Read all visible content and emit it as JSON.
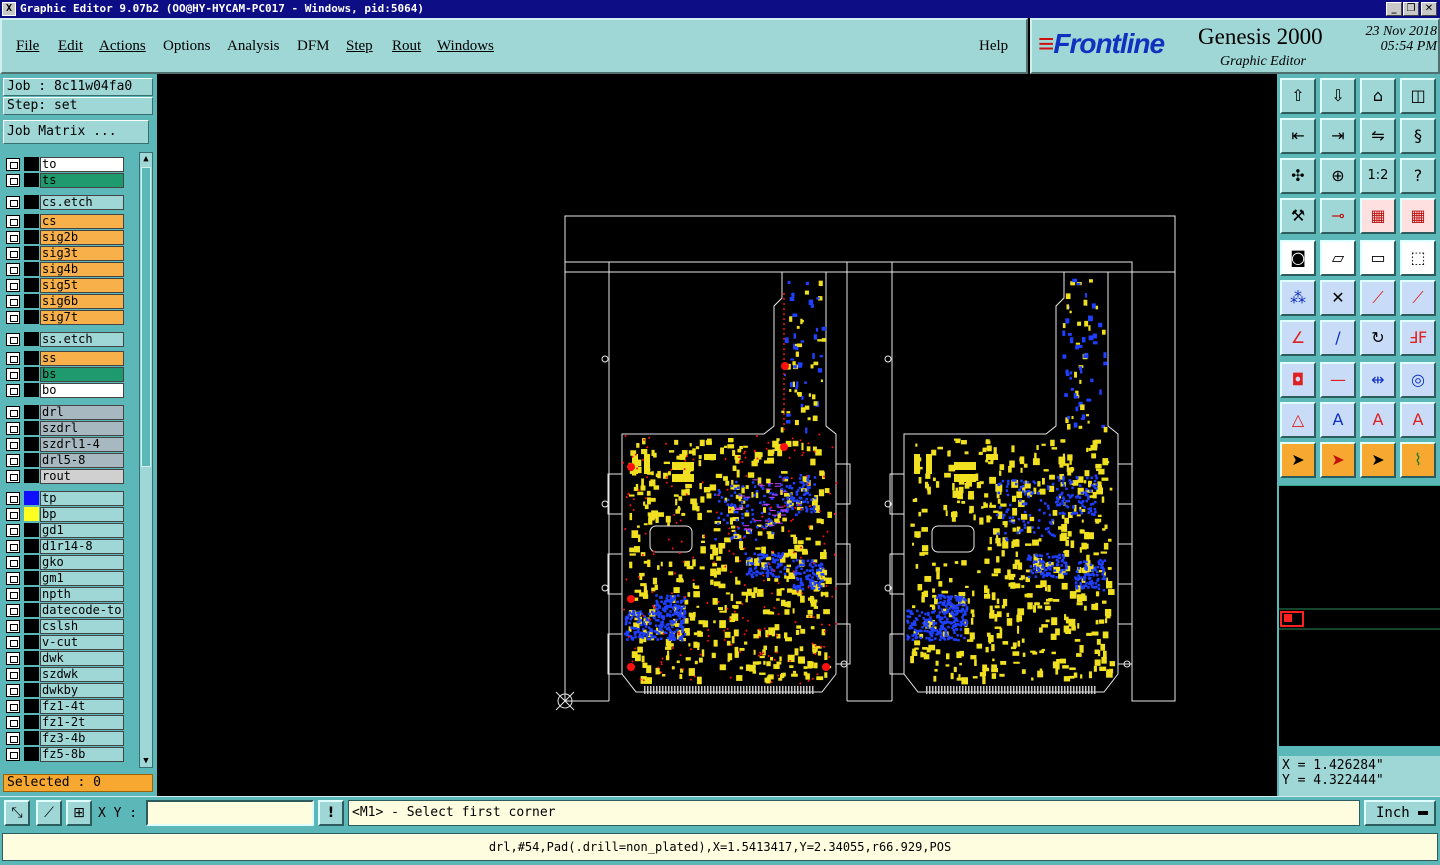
{
  "window": {
    "title": "Graphic Editor 9.07b2 (OO@HY-HYCAM-PC017 - Windows, pid:5064)",
    "minimize": "_",
    "restore": "❐",
    "close": "✕"
  },
  "menubar": {
    "items": [
      {
        "label": "File"
      },
      {
        "label": "Edit"
      },
      {
        "label": "Actions"
      },
      {
        "label": "Options"
      },
      {
        "label": "Analysis"
      },
      {
        "label": "DFM"
      },
      {
        "label": "Step"
      },
      {
        "label": "Rout"
      },
      {
        "label": "Windows"
      }
    ],
    "help": "Help"
  },
  "brand": {
    "logo": "Frontline",
    "product": "Genesis 2000",
    "subtitle": "Graphic Editor",
    "date": "23 Nov 2018",
    "time": "05:54 PM"
  },
  "job": {
    "job_label": "Job : 8c11w04fa0",
    "step_label": "Step: set",
    "matrix_button": "Job Matrix ..."
  },
  "layers": [
    {
      "name": "to",
      "color": "#ffffff",
      "swatch": "#000000"
    },
    {
      "name": "ts",
      "color": "#1e9a6e",
      "swatch": "#000000"
    },
    {
      "name": "cs.etch",
      "color": "#9fd6d6",
      "swatch": "#000000"
    },
    {
      "name": "cs",
      "color": "#f7b04a",
      "swatch": "#000000"
    },
    {
      "name": "sig2b",
      "color": "#f7b04a",
      "swatch": "#000000"
    },
    {
      "name": "sig3t",
      "color": "#f7b04a",
      "swatch": "#000000"
    },
    {
      "name": "sig4b",
      "color": "#f7b04a",
      "swatch": "#000000"
    },
    {
      "name": "sig5t",
      "color": "#f7b04a",
      "swatch": "#000000"
    },
    {
      "name": "sig6b",
      "color": "#f7b04a",
      "swatch": "#000000"
    },
    {
      "name": "sig7t",
      "color": "#f7b04a",
      "swatch": "#000000"
    },
    {
      "name": "ss.etch",
      "color": "#9fd6d6",
      "swatch": "#000000"
    },
    {
      "name": "ss",
      "color": "#f7b04a",
      "swatch": "#000000"
    },
    {
      "name": "bs",
      "color": "#1e9a6e",
      "swatch": "#000000"
    },
    {
      "name": "bo",
      "color": "#ffffff",
      "swatch": "#000000"
    },
    {
      "name": "drl",
      "color": "#a8b8c0",
      "swatch": "#000000"
    },
    {
      "name": "szdrl",
      "color": "#a8b8c0",
      "swatch": "#000000"
    },
    {
      "name": "szdrl1-4",
      "color": "#a8b8c0",
      "swatch": "#000000"
    },
    {
      "name": "drl5-8",
      "color": "#a8b8c0",
      "swatch": "#000000"
    },
    {
      "name": "rout",
      "color": "#d0d0d0",
      "swatch": "#000000"
    },
    {
      "name": "tp",
      "color": "#9fd6d6",
      "swatch": "#1010ff"
    },
    {
      "name": "bp",
      "color": "#9fd6d6",
      "swatch": "#ffff20"
    },
    {
      "name": "gd1",
      "color": "#9fd6d6",
      "swatch": "#000000"
    },
    {
      "name": "d1r14-8",
      "color": "#9fd6d6",
      "swatch": "#000000"
    },
    {
      "name": "gko",
      "color": "#9fd6d6",
      "swatch": "#000000"
    },
    {
      "name": "gm1",
      "color": "#9fd6d6",
      "swatch": "#000000"
    },
    {
      "name": "npth",
      "color": "#9fd6d6",
      "swatch": "#000000"
    },
    {
      "name": "datecode-to",
      "color": "#9fd6d6",
      "swatch": "#000000"
    },
    {
      "name": "cslsh",
      "color": "#9fd6d6",
      "swatch": "#000000"
    },
    {
      "name": "v-cut",
      "color": "#9fd6d6",
      "swatch": "#000000"
    },
    {
      "name": "dwk",
      "color": "#9fd6d6",
      "swatch": "#000000"
    },
    {
      "name": "szdwk",
      "color": "#9fd6d6",
      "swatch": "#000000"
    },
    {
      "name": "dwkby",
      "color": "#9fd6d6",
      "swatch": "#000000"
    },
    {
      "name": "fz1-4t",
      "color": "#9fd6d6",
      "swatch": "#000000"
    },
    {
      "name": "fz1-2t",
      "color": "#9fd6d6",
      "swatch": "#000000"
    },
    {
      "name": "fz3-4b",
      "color": "#9fd6d6",
      "swatch": "#000000"
    },
    {
      "name": "fz5-8b",
      "color": "#9fd6d6",
      "swatch": "#000000"
    }
  ],
  "selected_label": "Selected : 0",
  "toolbar": {
    "icons": [
      "view-top-icon",
      "view-bottom-icon",
      "home-icon",
      "split-view-icon",
      "zoom-left-icon",
      "zoom-right-icon",
      "flip-icon",
      "snake-icon",
      "fit-all-icon",
      "zoom-center-icon",
      "ratio-icon",
      "help-icon",
      "wrench-icon",
      "measure-pin-icon",
      "layers-red-icon",
      "layers-red2-icon",
      "pad-icon",
      "parallelogram-icon",
      "ruler-icon",
      "dotted-square-icon",
      "connect-icon",
      "cross-icon",
      "line-node-icon",
      "line-node2-icon",
      "angle-icon",
      "diagonal-icon",
      "rotate-icon",
      "mirror-f-icon",
      "pad-move-icon",
      "horizontal-line-icon",
      "dimension-icon",
      "overlap-icon",
      "triangle-icon",
      "triangle-a-icon",
      "triangle-ar-icon",
      "triangle-al-icon",
      "pointer-icon",
      "pointer-box-icon",
      "pointer-select-icon",
      "pointer-route-icon"
    ],
    "ratio_text": "1:2",
    "help_text": "?"
  },
  "coords": {
    "x": "X = 1.426284\"",
    "y": "Y = 4.322444\""
  },
  "bottom": {
    "xy_label": "X Y :",
    "xy_value": "",
    "alert": "!",
    "message": "<M1> - Select first corner",
    "unit": "Inch"
  },
  "status": "drl,#54,Pad(.drill=non_plated),X=1.5413417,Y=2.34055,r66.929,POS",
  "colors": {
    "panel": "#5cb8b8",
    "panel_light": "#9fd6d6",
    "canvas": "#000000",
    "outline": "#e8e8e8",
    "pad_yellow": "#f0e020",
    "pad_blue": "#2040ff",
    "pad_red": "#ff1010"
  }
}
